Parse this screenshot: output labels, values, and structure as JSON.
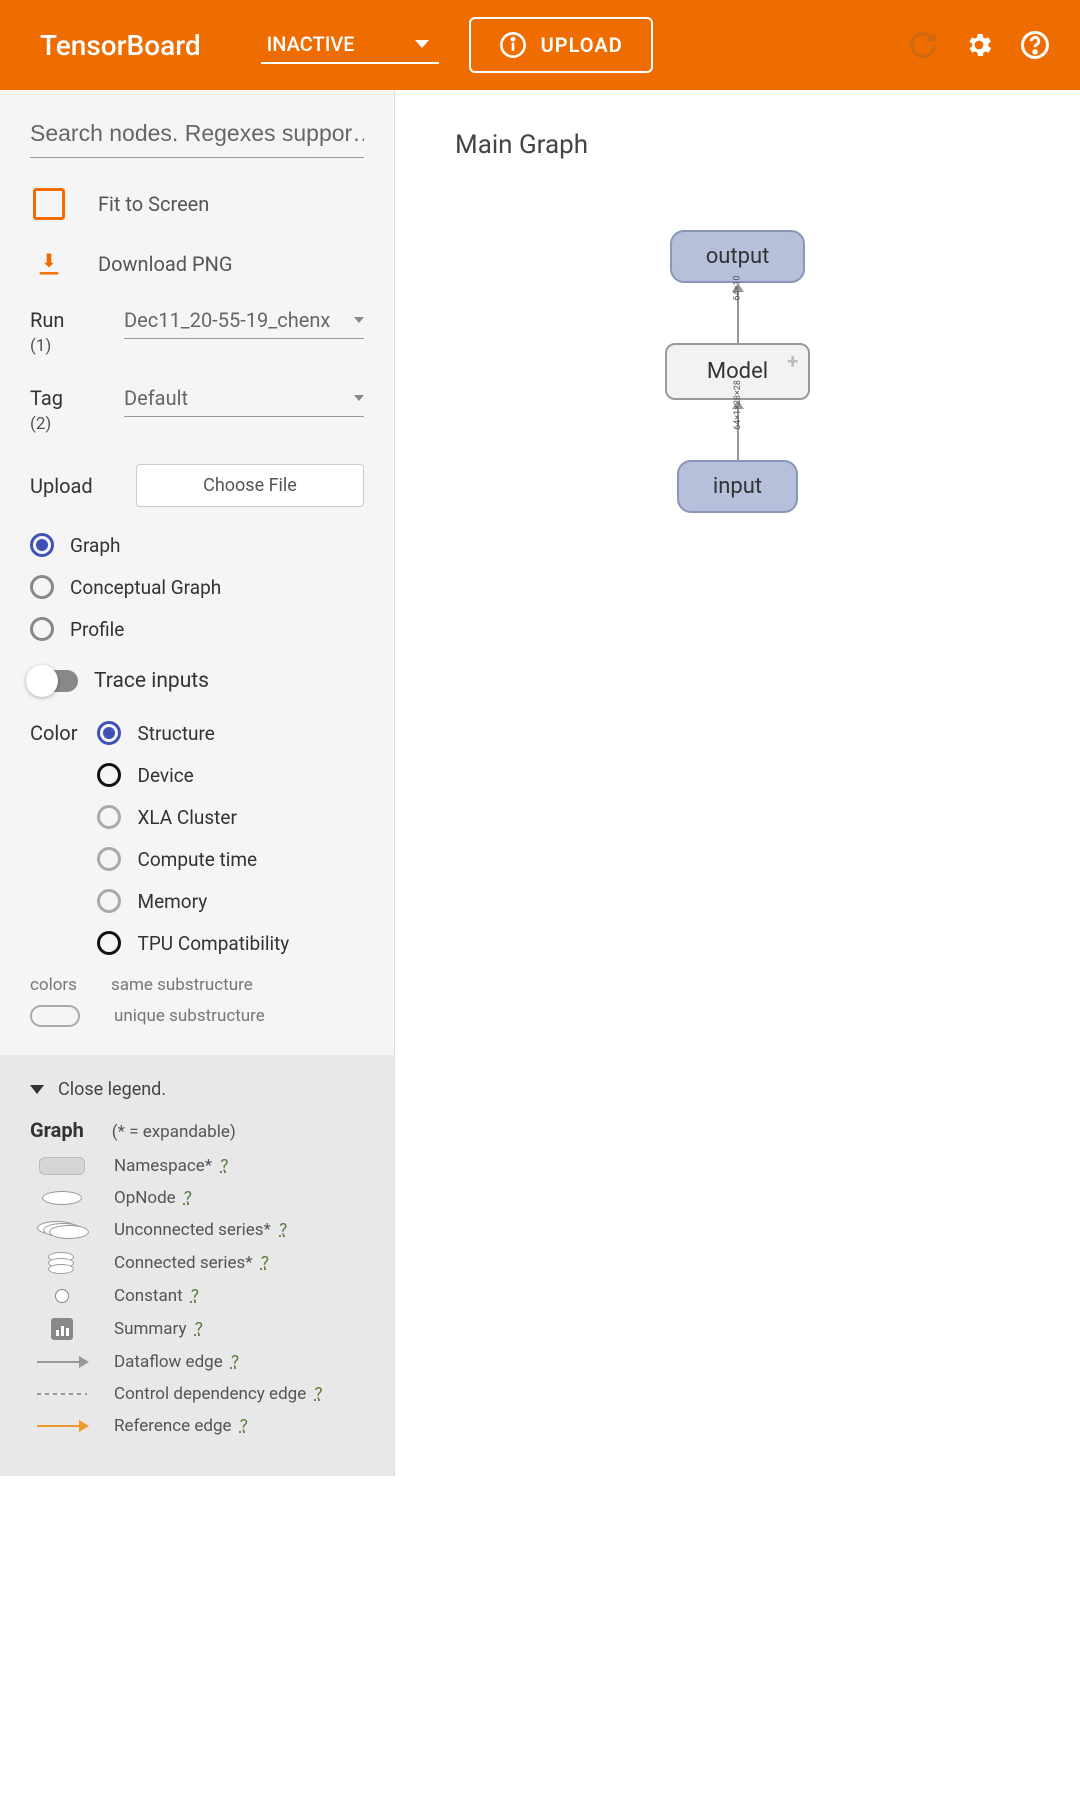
{
  "header": {
    "app_title": "TensorBoard",
    "inactive_label": "INACTIVE",
    "upload_button": "UPLOAD"
  },
  "sidebar": {
    "search_placeholder": "Search nodes. Regexes suppor…",
    "fit_label": "Fit to Screen",
    "download_label": "Download PNG",
    "run_label": "Run",
    "run_count": "(1)",
    "run_value": "Dec11_20-55-19_chenx",
    "tag_label": "Tag",
    "tag_count": "(2)",
    "tag_value": "Default",
    "upload_label": "Upload",
    "choose_file": "Choose File",
    "view_modes": [
      "Graph",
      "Conceptual Graph",
      "Profile"
    ],
    "trace_label": "Trace inputs",
    "color_label": "Color",
    "color_opts": [
      "Structure",
      "Device",
      "XLA Cluster",
      "Compute time",
      "Memory",
      "TPU Compatibility"
    ],
    "colors_footer_label": "colors",
    "colors_same": "same substructure",
    "colors_unique": "unique substructure"
  },
  "legend": {
    "close": "Close legend.",
    "title": "Graph",
    "title_sub": "(* = expandable)",
    "items": [
      "Namespace* ",
      "OpNode ",
      "Unconnected series* ",
      "Connected series* ",
      "Constant ",
      "Summary ",
      "Dataflow edge ",
      "Control dependency edge ",
      "Reference edge "
    ],
    "q": "?"
  },
  "canvas": {
    "title": "Main Graph",
    "output": "output",
    "model": "Model",
    "input": "input",
    "edge1": "64×10",
    "edge2": "64×1×28×28"
  }
}
